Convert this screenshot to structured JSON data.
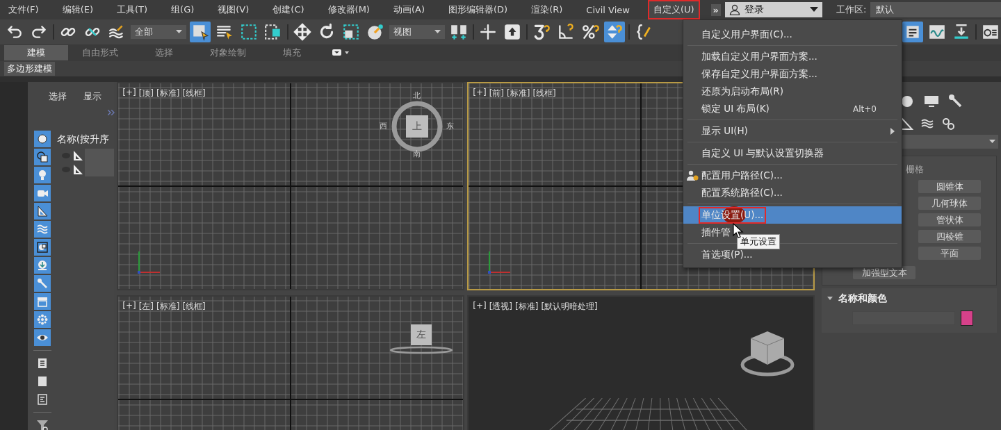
{
  "menu_bar": {
    "items": [
      {
        "label": "文件(F)",
        "selected": false,
        "annotated": false
      },
      {
        "label": "编辑(E)",
        "selected": false,
        "annotated": false
      },
      {
        "label": "工具(T)",
        "selected": false,
        "annotated": false
      },
      {
        "label": "组(G)",
        "selected": false,
        "annotated": false
      },
      {
        "label": "视图(V)",
        "selected": false,
        "annotated": false
      },
      {
        "label": "创建(C)",
        "selected": false,
        "annotated": false
      },
      {
        "label": "修改器(M)",
        "selected": false,
        "annotated": false
      },
      {
        "label": "动画(A)",
        "selected": false,
        "annotated": false
      },
      {
        "label": "图形编辑器(D)",
        "selected": false,
        "annotated": false
      },
      {
        "label": "渲染(R)",
        "selected": false,
        "annotated": false
      },
      {
        "label": "Civil View",
        "selected": false,
        "annotated": false
      },
      {
        "label": "自定义(U)",
        "selected": true,
        "annotated": true
      }
    ],
    "overflow": "»",
    "login": "登录",
    "workspace_label": "工作区:",
    "workspace": "默认"
  },
  "toolbar": {
    "left": [
      {
        "kind": "undo",
        "active": false
      },
      {
        "kind": "redo",
        "active": false
      },
      {
        "kind": "sep"
      },
      {
        "kind": "link",
        "active": false
      },
      {
        "kind": "unlink",
        "active": false
      },
      {
        "kind": "bind",
        "active": false
      },
      {
        "kind": "dropdown",
        "value": "全部"
      },
      {
        "kind": "select",
        "active": true
      },
      {
        "kind": "selectlist",
        "active": false
      },
      {
        "kind": "region",
        "active": false
      },
      {
        "kind": "crossing",
        "active": false
      },
      {
        "kind": "sep"
      },
      {
        "kind": "move",
        "active": false
      },
      {
        "kind": "rotate",
        "active": false
      },
      {
        "kind": "scale",
        "active": false
      },
      {
        "kind": "place",
        "active": false
      },
      {
        "kind": "dropdown",
        "value": "视图"
      },
      {
        "kind": "pivot",
        "active": false
      },
      {
        "kind": "sep"
      },
      {
        "kind": "cross",
        "active": false
      },
      {
        "kind": "up",
        "active": false
      },
      {
        "kind": "sep"
      },
      {
        "kind": "snap",
        "active": false
      },
      {
        "kind": "angle",
        "active": false
      },
      {
        "kind": "percent",
        "active": false
      },
      {
        "kind": "spinner",
        "active": true
      },
      {
        "kind": "sep"
      },
      {
        "kind": "brace",
        "active": false
      }
    ],
    "right": [
      {
        "kind": "editor",
        "active": true
      },
      {
        "kind": "curve",
        "active": false
      },
      {
        "kind": "render",
        "active": false
      },
      {
        "kind": "sep"
      },
      {
        "kind": "frame",
        "active": false
      }
    ]
  },
  "ribbon": {
    "tabs": [
      {
        "label": "建模",
        "selected": true
      },
      {
        "label": "自由形式",
        "selected": false
      },
      {
        "label": "选择",
        "selected": false
      },
      {
        "label": "对象绘制",
        "selected": false
      },
      {
        "label": "填充",
        "selected": false
      }
    ],
    "panel_button": "多边形建模"
  },
  "scene_explorer": {
    "tabs": [
      {
        "label": "选择",
        "selected": false
      },
      {
        "label": "显示",
        "selected": false
      }
    ],
    "filters": [
      {
        "kind": "geometry",
        "active": true
      },
      {
        "kind": "shape",
        "active": true
      },
      {
        "kind": "light",
        "active": true
      },
      {
        "kind": "camera",
        "active": true
      },
      {
        "kind": "helper",
        "active": true
      },
      {
        "kind": "warp",
        "active": true
      },
      {
        "kind": "group",
        "active": true
      },
      {
        "kind": "xref",
        "active": true
      },
      {
        "kind": "bone",
        "active": true
      },
      {
        "kind": "container",
        "active": true
      },
      {
        "kind": "particle",
        "active": true
      },
      {
        "kind": "eye",
        "active": true
      }
    ],
    "column": "名称(按升序",
    "rows": [
      {
        "kind": "helper"
      },
      {
        "kind": "helper"
      }
    ]
  },
  "viewports": [
    {
      "labels": [
        "[+]",
        "[顶]",
        "[标准]",
        "[线框]"
      ],
      "selected": false,
      "kind": "ortho",
      "viewcube": {
        "face": "上",
        "compass": [
          "北",
          "东",
          "南",
          "西"
        ]
      }
    },
    {
      "labels": [
        "[+]",
        "[前]",
        "[标准]",
        "[线框]"
      ],
      "selected": true,
      "kind": "ortho"
    },
    {
      "labels": [
        "[+]",
        "[左]",
        "[标准]",
        "[线框]"
      ],
      "selected": false,
      "kind": "ortho",
      "viewcube": {
        "face": "左"
      }
    },
    {
      "labels": [
        "[+]",
        "[透视]",
        "[标准]",
        "[默认明暗处理]"
      ],
      "selected": false,
      "kind": "perspective"
    }
  ],
  "command_panel": {
    "rollout_label": "栅格",
    "buttons": [
      "圆锥体",
      "几何球体",
      "管状体",
      "四棱锥",
      "平面"
    ],
    "wide_button": "加强型文本",
    "name_color": {
      "title": "名称和颜色",
      "color": "#d6418a"
    }
  },
  "customize_menu": {
    "items": [
      {
        "label": "自定义用户界面(C)...",
        "separator_after": true,
        "selected": false,
        "annotated": false
      },
      {
        "label": "加载自定义用户界面方案...",
        "selected": false,
        "annotated": false
      },
      {
        "label": "保存自定义用户界面方案...",
        "selected": false,
        "annotated": false
      },
      {
        "label": "还原为启动布局(R)",
        "selected": false,
        "annotated": false
      },
      {
        "label": "锁定 UI 布局(K)",
        "shortcut": "Alt+0",
        "separator_after": true,
        "selected": false,
        "annotated": false
      },
      {
        "label": "显示 UI(H)",
        "submenu": true,
        "separator_after": true,
        "selected": false,
        "annotated": false
      },
      {
        "label": "自定义 UI 与默认设置切换器",
        "separator_after": true,
        "selected": false,
        "annotated": false
      },
      {
        "label": "配置用户路径(C)...",
        "icon": true,
        "selected": false,
        "annotated": false
      },
      {
        "label": "配置系统路径(C)...",
        "separator_after": true,
        "selected": false,
        "annotated": false
      },
      {
        "label": "单位设置(U)...",
        "selected": true,
        "annotated": true
      },
      {
        "label": "插件管",
        "separator_after": true,
        "selected": false,
        "annotated": false
      },
      {
        "label": "首选项(P)...",
        "selected": false,
        "annotated": false
      }
    ]
  },
  "tooltip": "单元设置"
}
